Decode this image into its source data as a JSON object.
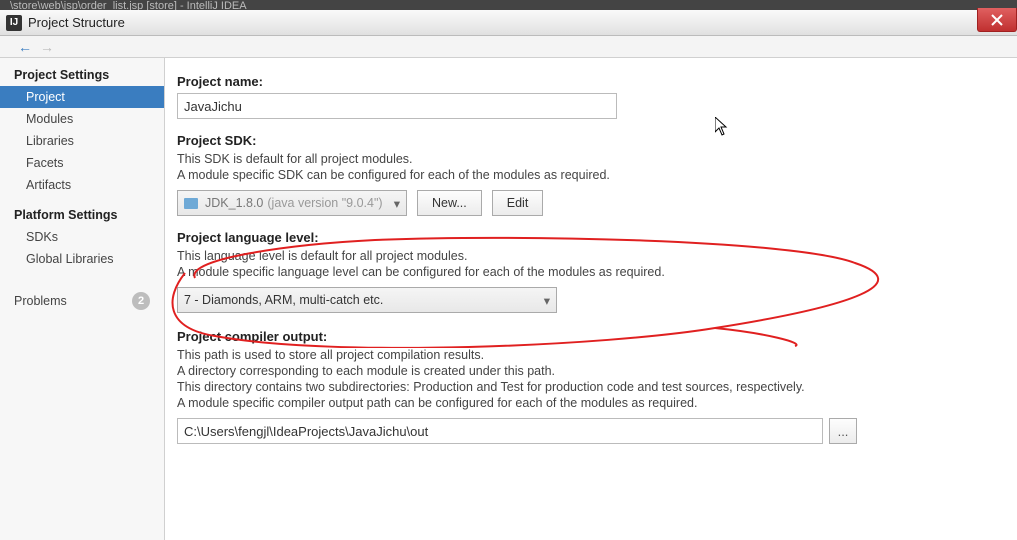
{
  "bg_tab": "\\store\\web\\jsp\\order_list.jsp [store] - IntelliJ IDEA",
  "window": {
    "title": "Project Structure"
  },
  "sidebar": {
    "groups": [
      {
        "header": "Project Settings",
        "items": [
          {
            "label": "Project",
            "selected": true
          },
          {
            "label": "Modules"
          },
          {
            "label": "Libraries"
          },
          {
            "label": "Facets"
          },
          {
            "label": "Artifacts"
          }
        ]
      },
      {
        "header": "Platform Settings",
        "items": [
          {
            "label": "SDKs"
          },
          {
            "label": "Global Libraries"
          }
        ]
      }
    ],
    "problems": {
      "label": "Problems",
      "count": "2"
    }
  },
  "main": {
    "project_name": {
      "label": "Project name:",
      "value": "JavaJichu"
    },
    "sdk": {
      "label": "Project SDK:",
      "desc1": "This SDK is default for all project modules.",
      "desc2": "A module specific SDK can be configured for each of the modules as required.",
      "selected": "JDK_1.8.0",
      "hint": "(java version \"9.0.4\")",
      "new_btn": "New...",
      "edit_btn": "Edit"
    },
    "lang": {
      "label": "Project language level:",
      "desc1": "This language level is default for all project modules.",
      "desc2": "A module specific language level can be configured for each of the modules as required.",
      "selected": "7 - Diamonds, ARM, multi-catch etc."
    },
    "output": {
      "label": "Project compiler output:",
      "desc1": "This path is used to store all project compilation results.",
      "desc2": "A directory corresponding to each module is created under this path.",
      "desc3": "This directory contains two subdirectories: Production and Test for production code and test sources, respectively.",
      "desc4": "A module specific compiler output path can be configured for each of the modules as required.",
      "value": "C:\\Users\\fengjl\\IdeaProjects\\JavaJichu\\out",
      "browse": "..."
    }
  }
}
